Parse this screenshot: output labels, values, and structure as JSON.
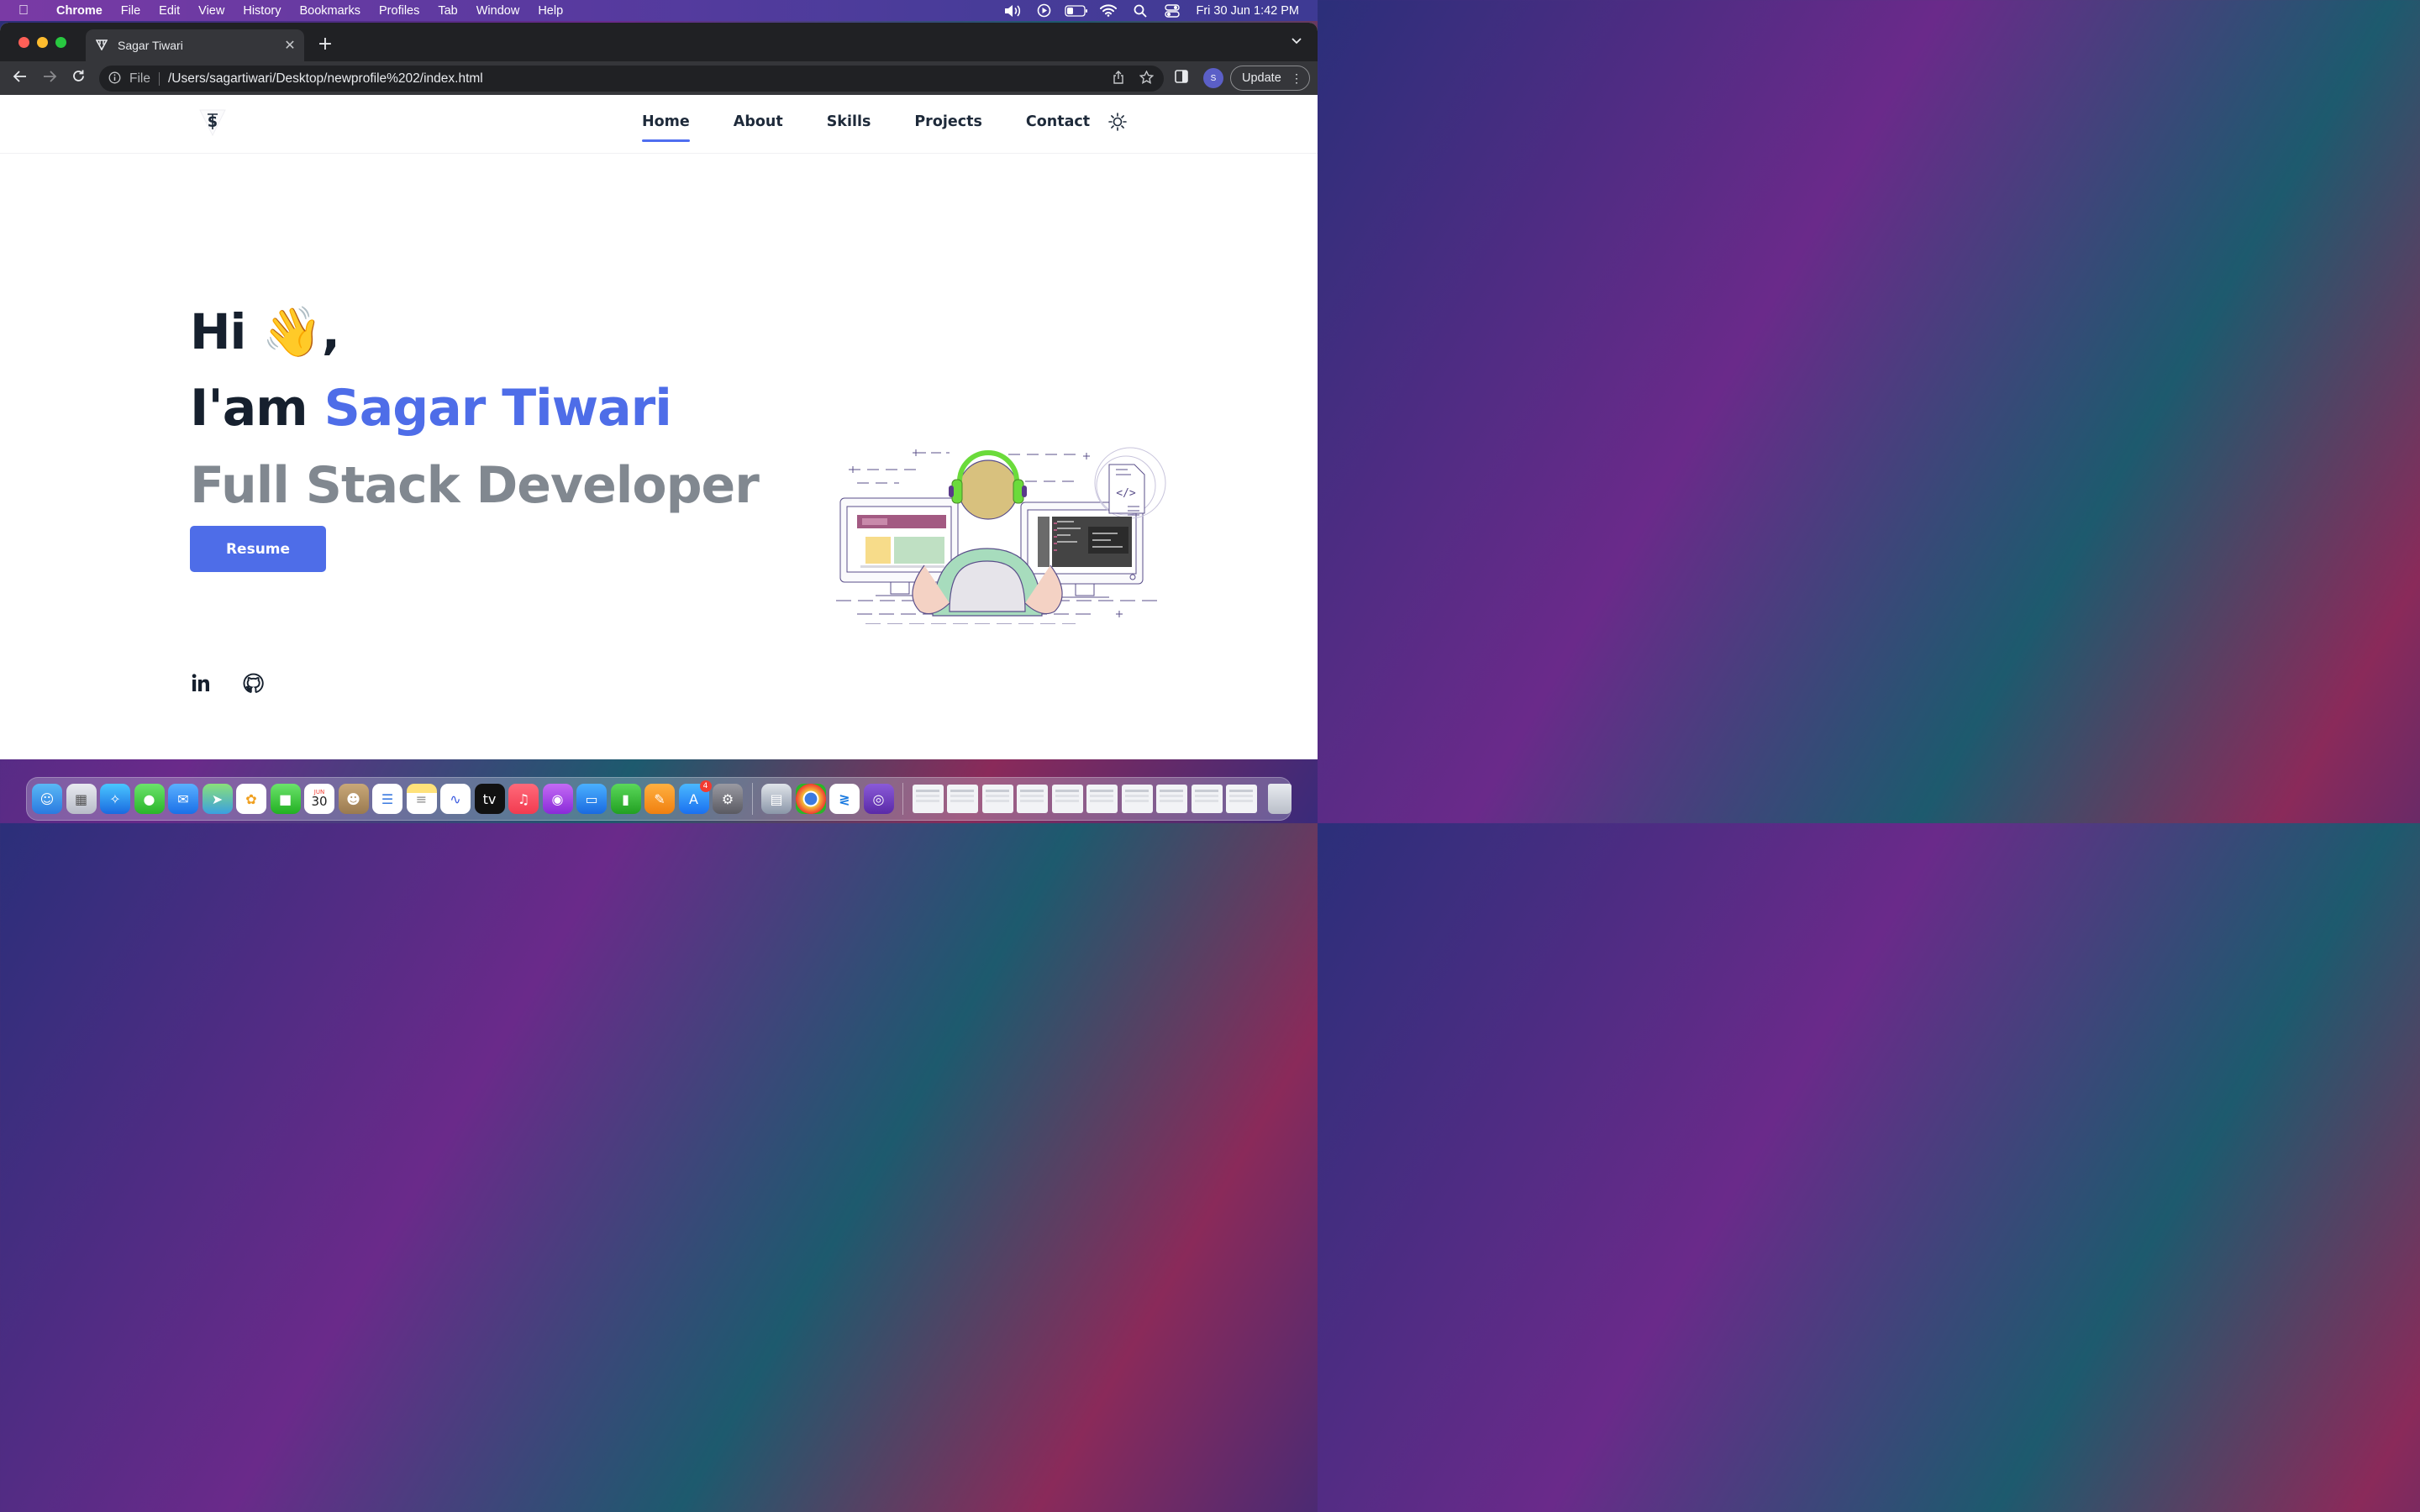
{
  "menubar": {
    "app_name": "Chrome",
    "items": [
      "File",
      "Edit",
      "View",
      "History",
      "Bookmarks",
      "Profiles",
      "Tab",
      "Window",
      "Help"
    ],
    "clock": "Fri 30 Jun  1:42 PM"
  },
  "browser": {
    "tab_title": "Sagar Tiwari",
    "tab_close": "✕",
    "new_tab": "+",
    "scheme_label": "File",
    "url": "/Users/sagartiwari/Desktop/newprofile%202/index.html",
    "profile_initial": "S",
    "update_label": "Update"
  },
  "site": {
    "nav": [
      "Home",
      "About",
      "Skills",
      "Projects",
      "Contact"
    ],
    "active_nav": "Home",
    "accent_color": "#4e6de8"
  },
  "hero": {
    "greeting": "Hi 👋,",
    "intro_prefix": "I'am ",
    "name": "Sagar Tiwari",
    "role": "Full Stack Developer",
    "resume_label": "Resume"
  },
  "dock": {
    "calendar_month": "JUN",
    "calendar_day": "30",
    "appstore_badge": "4"
  }
}
